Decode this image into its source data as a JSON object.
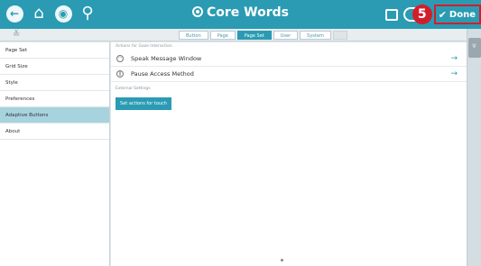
{
  "app": {
    "title": "Core Words",
    "step_badge": "5",
    "done_label": "Done",
    "colors": {
      "accent": "#2a9bb3",
      "highlight": "#d21e2b",
      "selected_row": "#a6d3de"
    }
  },
  "tabs": [
    {
      "label": "Button",
      "active": false
    },
    {
      "label": "Page",
      "active": false
    },
    {
      "label": "Page Set",
      "active": true
    },
    {
      "label": "User",
      "active": false
    },
    {
      "label": "System",
      "active": false
    }
  ],
  "sidebar": {
    "items": [
      {
        "label": "Page Set"
      },
      {
        "label": "Grid Size"
      },
      {
        "label": "Style"
      },
      {
        "label": "Preferences"
      },
      {
        "label": "Adaptive Buttons",
        "selected": true
      },
      {
        "label": "About"
      }
    ]
  },
  "main": {
    "section1_heading": "Actions for Gaze Interaction",
    "rows": [
      {
        "label": "Speak Message Window",
        "icon": "speaker-icon"
      },
      {
        "label": "Pause Access Method",
        "icon": "pause-icon"
      }
    ],
    "section2_heading": "External Settings",
    "touch_button_label": "Set actions for touch"
  }
}
